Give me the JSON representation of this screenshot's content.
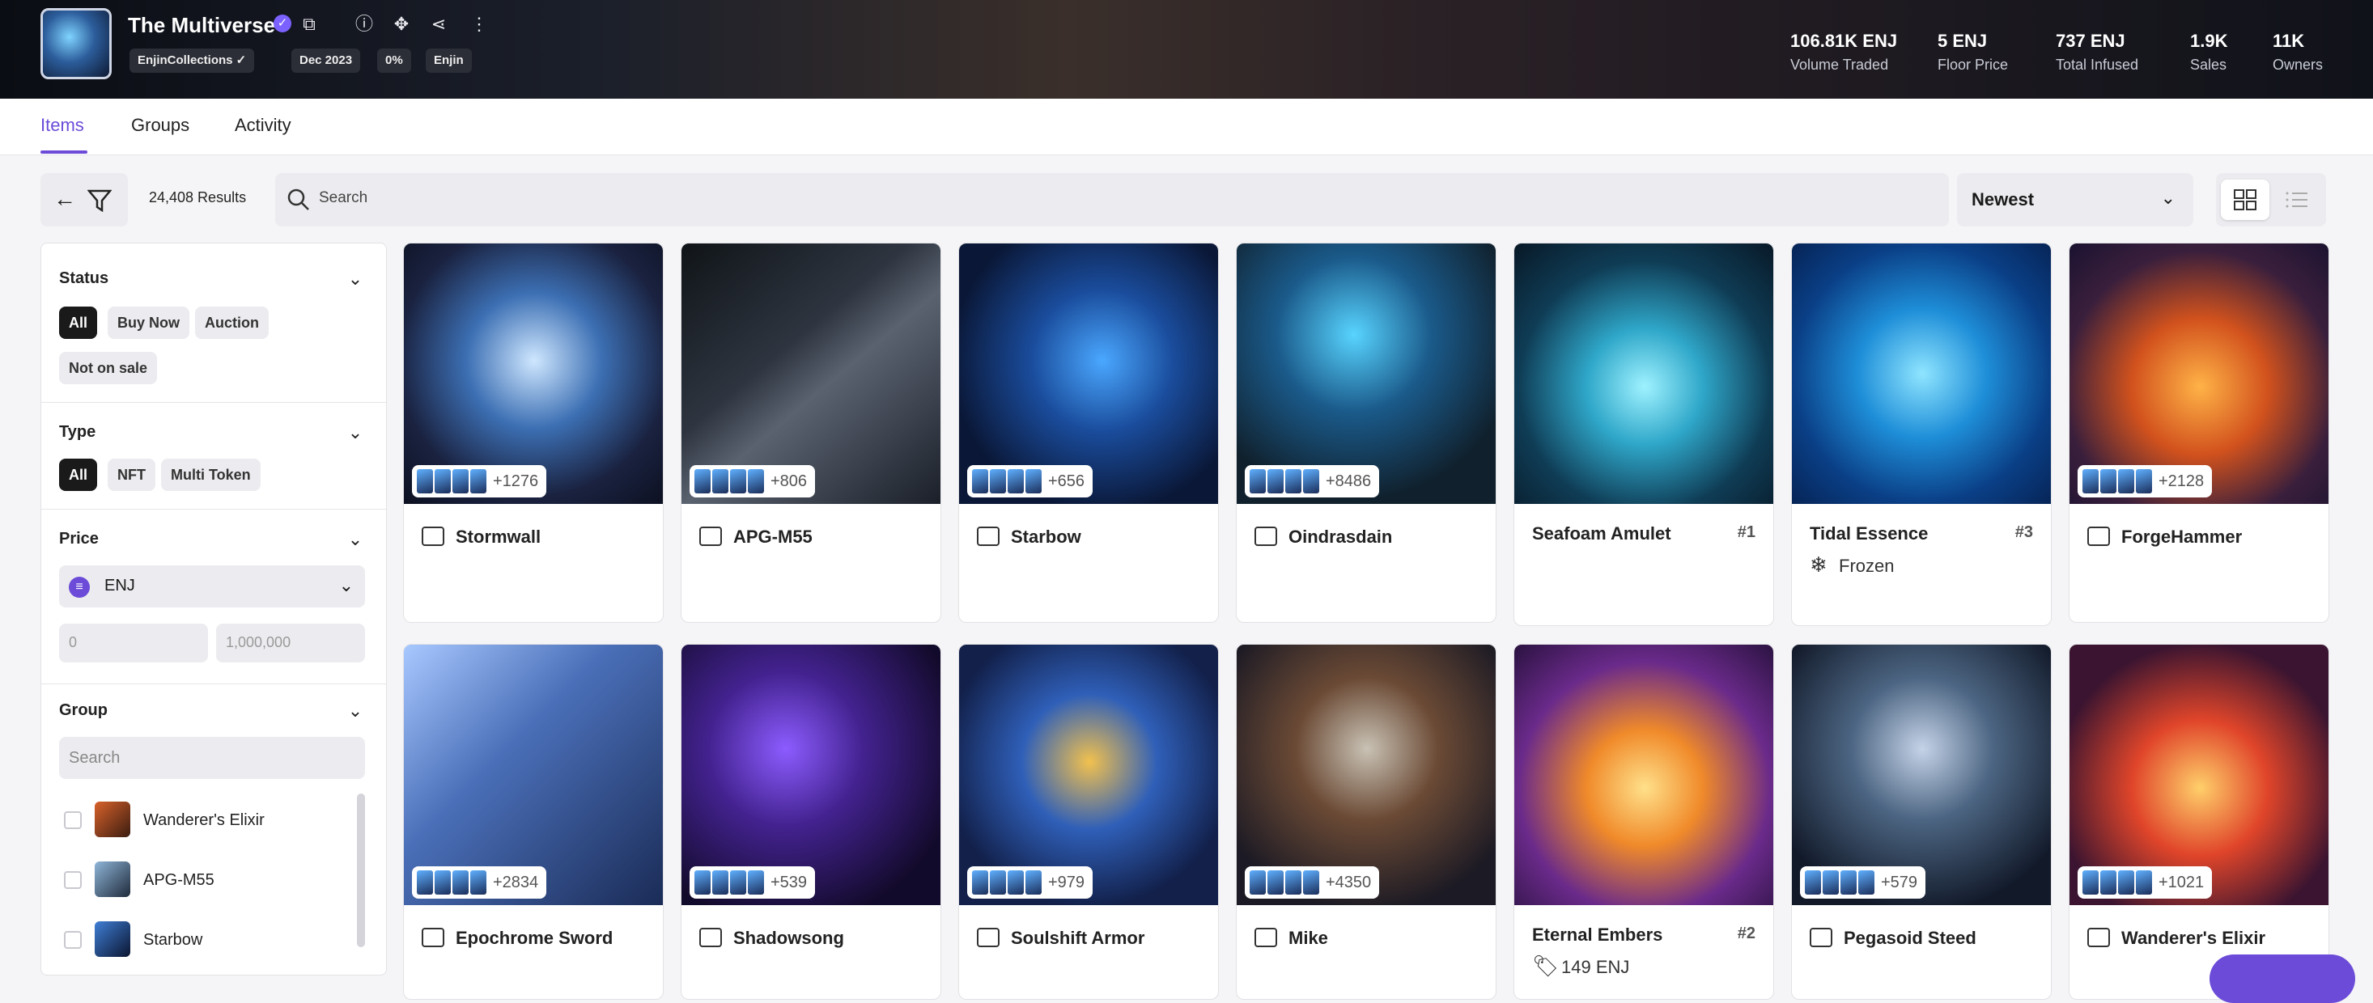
{
  "header": {
    "title": "The Multiverse",
    "chips": [
      "EnjinCollections",
      "Dec 2023",
      "0%",
      "Enjin"
    ],
    "stats": [
      {
        "value": "106.81K ENJ",
        "label": "Volume Traded"
      },
      {
        "value": "5 ENJ",
        "label": "Floor Price"
      },
      {
        "value": "737 ENJ",
        "label": "Total Infused"
      },
      {
        "value": "1.9K",
        "label": "Sales"
      },
      {
        "value": "11K",
        "label": "Owners"
      }
    ]
  },
  "tabs": [
    "Items",
    "Groups",
    "Activity"
  ],
  "toolbar": {
    "results": "24,408 Results",
    "search_placeholder": "Search",
    "sort": "Newest"
  },
  "sidebar": {
    "status": {
      "title": "Status",
      "options": [
        "All",
        "Buy Now",
        "Auction",
        "Not on sale"
      ]
    },
    "type": {
      "title": "Type",
      "options": [
        "All",
        "NFT",
        "Multi Token"
      ]
    },
    "price": {
      "title": "Price",
      "currency": "ENJ",
      "min_placeholder": "0",
      "max_placeholder": "1,000,000"
    },
    "group": {
      "title": "Group",
      "search_placeholder": "Search",
      "items": [
        "Wanderer's Elixir",
        "APG-M55",
        "Starbow"
      ]
    }
  },
  "cards": [
    {
      "name": "Stormwall",
      "count": "+1276"
    },
    {
      "name": "APG-M55",
      "count": "+806"
    },
    {
      "name": "Starbow",
      "count": "+656"
    },
    {
      "name": "Oindrasdain",
      "count": "+8486"
    },
    {
      "name": "Seafoam Amulet",
      "num": "#1"
    },
    {
      "name": "Tidal Essence",
      "num": "#3",
      "sub": "Frozen"
    },
    {
      "name": "ForgeHammer",
      "count": "+2128"
    },
    {
      "name": "Epochrome Sword",
      "count": "+2834"
    },
    {
      "name": "Shadowsong",
      "count": "+539"
    },
    {
      "name": "Soulshift Armor",
      "count": "+979"
    },
    {
      "name": "Mike",
      "count": "+4350"
    },
    {
      "name": "Eternal Embers",
      "num": "#2",
      "sub": "149 ENJ"
    },
    {
      "name": "Pegasoid Steed",
      "count": "+579"
    },
    {
      "name": "Wanderer's Elixir",
      "count": "+1021"
    }
  ]
}
